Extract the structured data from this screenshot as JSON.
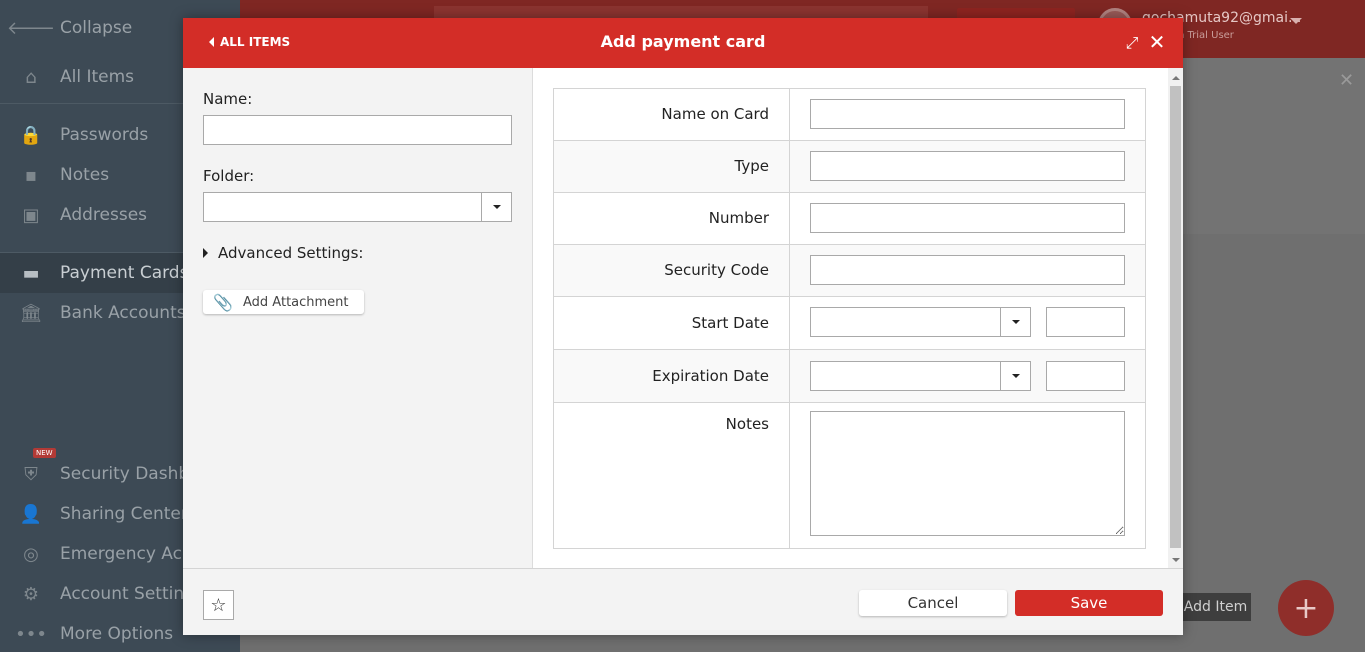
{
  "sidebar": {
    "items": [
      {
        "label": "Collapse",
        "icon": "arrow-left-icon"
      },
      {
        "label": "All Items",
        "icon": "home-icon"
      },
      {
        "label": "Passwords",
        "icon": "lock-icon"
      },
      {
        "label": "Notes",
        "icon": "note-icon"
      },
      {
        "label": "Addresses",
        "icon": "address-icon"
      },
      {
        "label": "Payment Cards",
        "icon": "card-icon"
      },
      {
        "label": "Bank Accounts",
        "icon": "bank-icon"
      },
      {
        "label": "Security Dashbo",
        "icon": "shield-icon",
        "badge": "NEW"
      },
      {
        "label": "Sharing Center",
        "icon": "users-icon"
      },
      {
        "label": "Emergency Acce",
        "icon": "lifebuoy-icon"
      },
      {
        "label": "Account Settings",
        "icon": "gear-icon"
      },
      {
        "label": "More Options",
        "icon": "dots-icon"
      }
    ]
  },
  "topbar": {
    "user_email": "gochamuta92@gmai...",
    "user_sub": "n Trial User"
  },
  "background": {
    "add_item_label": "Add Item",
    "fab_label": "+"
  },
  "modal": {
    "back_label": "ALL ITEMS",
    "title": "Add payment card",
    "left": {
      "name_label": "Name:",
      "name_value": "",
      "folder_label": "Folder:",
      "folder_value": "",
      "advanced_label": "Advanced Settings:",
      "attachment_label": "Add Attachment"
    },
    "form": {
      "name_on_card": "Name on Card",
      "type": "Type",
      "number": "Number",
      "security_code": "Security Code",
      "start_date": "Start Date",
      "expiration_date": "Expiration Date",
      "notes": "Notes"
    },
    "footer": {
      "cancel_label": "Cancel",
      "save_label": "Save"
    }
  },
  "colors": {
    "accent": "#d32d27",
    "sidebar": "#3d4a55"
  }
}
